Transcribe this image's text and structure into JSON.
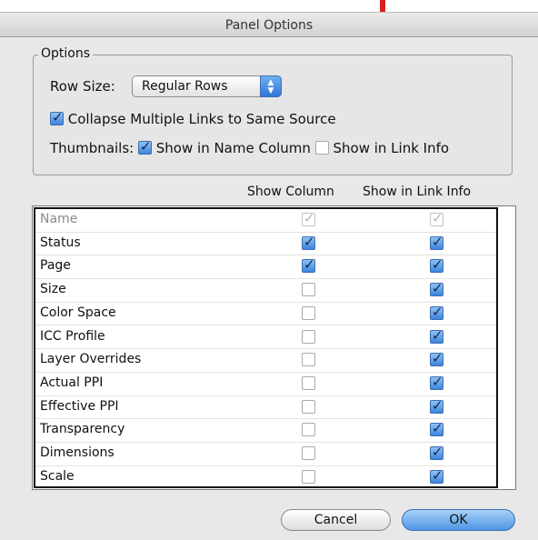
{
  "window": {
    "title": "Panel Options"
  },
  "options": {
    "legend": "Options",
    "row_size_label": "Row Size:",
    "row_size_value": "Regular Rows",
    "collapse_label": "Collapse Multiple Links to Same Source",
    "collapse_checked": true,
    "thumbnails_label": "Thumbnails:",
    "thumb_name_label": "Show in Name Column",
    "thumb_name_checked": true,
    "thumb_info_label": "Show in Link Info",
    "thumb_info_checked": false
  },
  "columns": {
    "show_column": "Show Column",
    "show_in_link_info": "Show in Link Info"
  },
  "rows": [
    {
      "label": "Name",
      "show_column": true,
      "show_in_link_info": true,
      "disabled": true
    },
    {
      "label": "Status",
      "show_column": true,
      "show_in_link_info": true
    },
    {
      "label": "Page",
      "show_column": true,
      "show_in_link_info": true
    },
    {
      "label": "Size",
      "show_column": false,
      "show_in_link_info": true
    },
    {
      "label": "Color Space",
      "show_column": false,
      "show_in_link_info": true
    },
    {
      "label": "ICC Profile",
      "show_column": false,
      "show_in_link_info": true
    },
    {
      "label": "Layer Overrides",
      "show_column": false,
      "show_in_link_info": true
    },
    {
      "label": "Actual PPI",
      "show_column": false,
      "show_in_link_info": true
    },
    {
      "label": "Effective PPI",
      "show_column": false,
      "show_in_link_info": true
    },
    {
      "label": "Transparency",
      "show_column": false,
      "show_in_link_info": true
    },
    {
      "label": "Dimensions",
      "show_column": false,
      "show_in_link_info": true
    },
    {
      "label": "Scale",
      "show_column": false,
      "show_in_link_info": true
    }
  ],
  "buttons": {
    "cancel": "Cancel",
    "ok": "OK"
  },
  "colors": {
    "accent": "#3d85dc",
    "dialog_bg": "#e8e8e8",
    "marker": "#d81e1e"
  }
}
